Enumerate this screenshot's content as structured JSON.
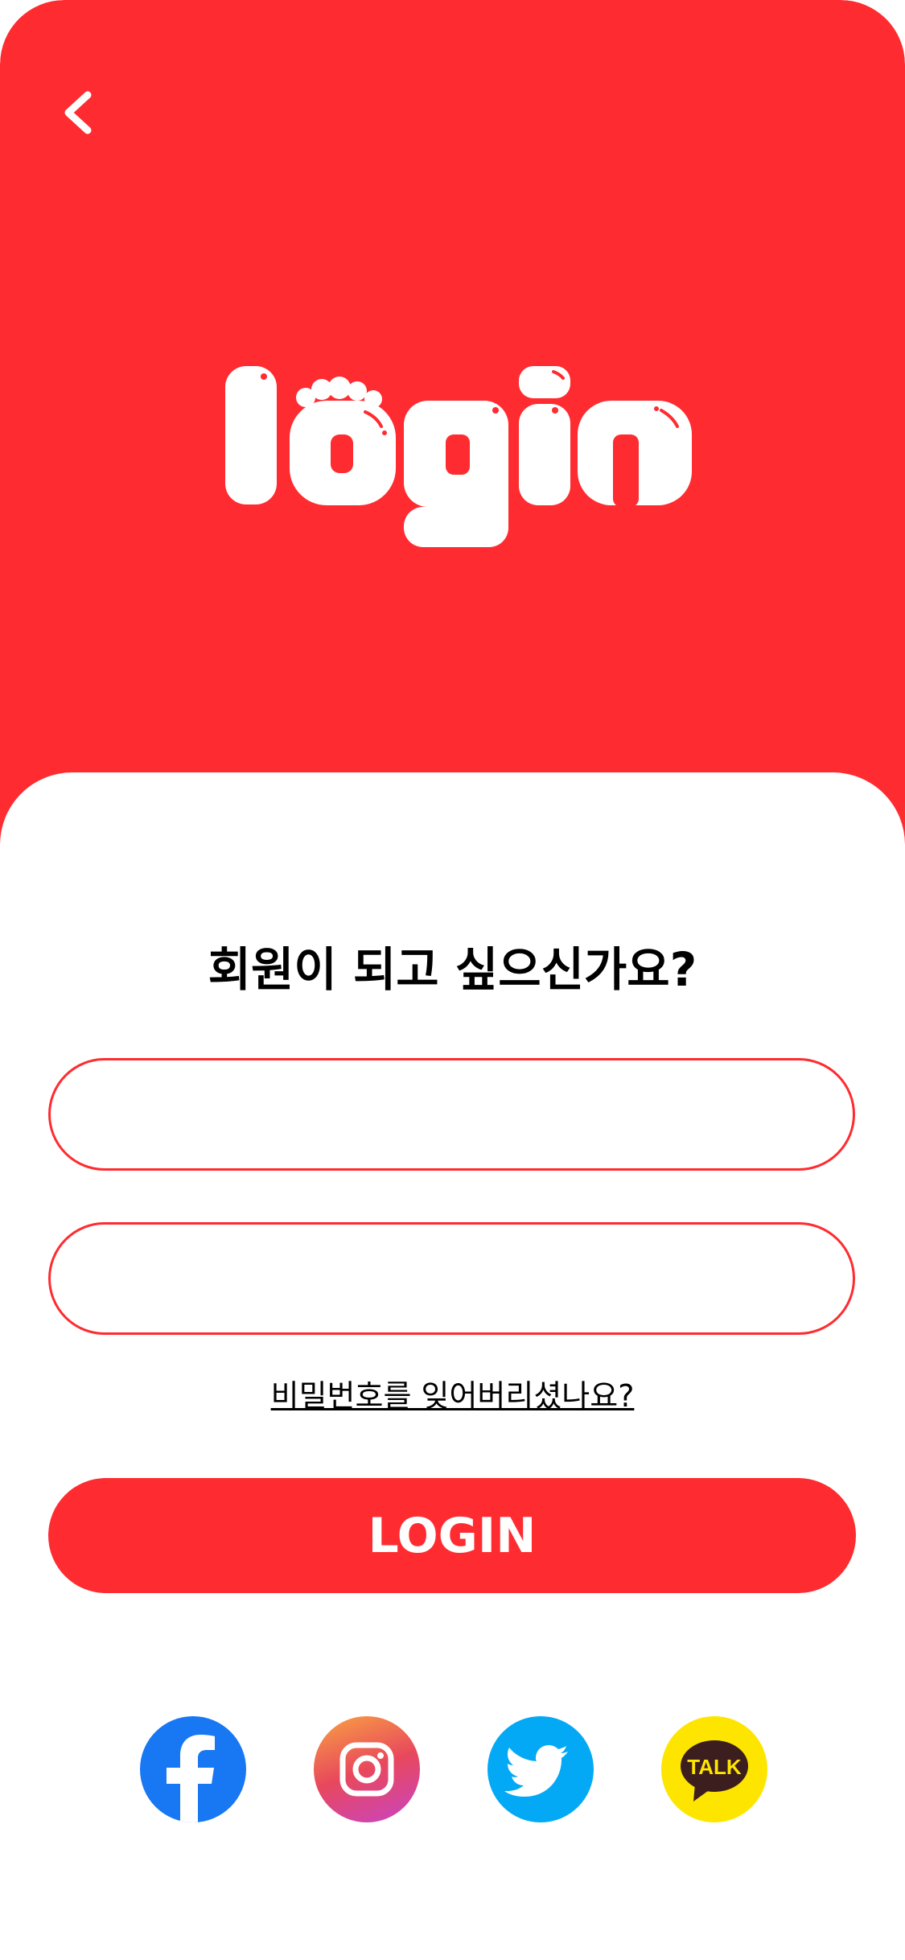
{
  "colors": {
    "accent": "#fe2c30",
    "facebook": "#1877f2",
    "twitter": "#03a9f4",
    "kakao": "#fee500"
  },
  "header": {
    "back_icon": "chevron-left-icon",
    "logo_text": "login"
  },
  "form": {
    "title": "회원이 되고 싶으신가요?",
    "username": {
      "value": "",
      "placeholder": ""
    },
    "password": {
      "value": "",
      "placeholder": ""
    },
    "forgot_password": "비밀번호를 잊어버리셨나요?",
    "login_label": "LOGIN"
  },
  "social": {
    "facebook_icon": "facebook-icon",
    "instagram_icon": "instagram-icon",
    "twitter_icon": "twitter-icon",
    "kakao_icon": "kakaotalk-icon",
    "kakao_label": "TALK"
  }
}
